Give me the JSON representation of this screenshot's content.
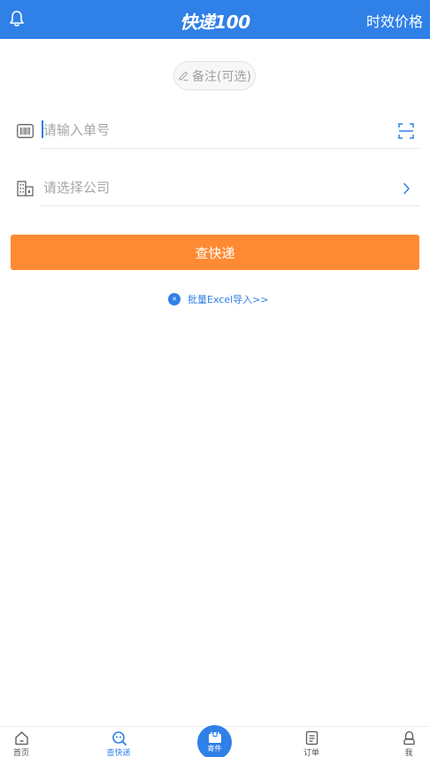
{
  "header": {
    "logo_text": "快递100",
    "right_label": "时效价格",
    "bell_icon": "bell-icon"
  },
  "remark": {
    "label": "备注(可选)",
    "icon": "pencil-icon"
  },
  "tracking_input": {
    "placeholder": "请输入单号",
    "icon": "barcode-icon",
    "scan_icon": "scan-icon"
  },
  "company_select": {
    "placeholder": "请选择公司",
    "icon": "building-icon",
    "chevron_icon": "chevron-right-icon"
  },
  "query_button": {
    "label": "查快递"
  },
  "excel_import": {
    "label": "批量Excel导入>>",
    "icon": "excel-icon"
  },
  "bottom_nav": {
    "items": [
      {
        "label": "首页",
        "icon": "home-icon",
        "active": false
      },
      {
        "label": "查快递",
        "icon": "search-package-icon",
        "active": true
      },
      {
        "label": "寄件",
        "icon": "send-package-icon",
        "active": false
      },
      {
        "label": "订单",
        "icon": "order-list-icon",
        "active": false
      },
      {
        "label": "我",
        "icon": "user-icon",
        "active": false
      }
    ]
  },
  "colors": {
    "primary": "#2f80e7",
    "button": "#ff8a33"
  }
}
